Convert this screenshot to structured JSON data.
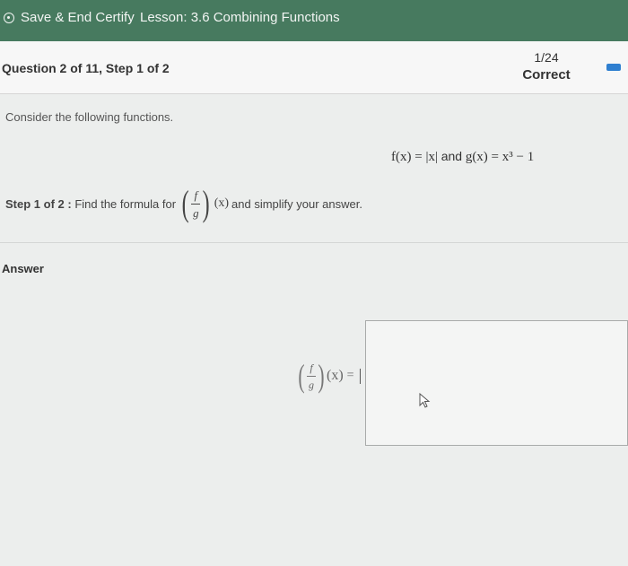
{
  "topbar": {
    "save_end_label": "Save & End Certify",
    "lesson_title": "Lesson: 3.6 Combining Functions"
  },
  "question": {
    "label": "Question 2 of 11, Step 1 of 2",
    "progress_count": "1/24",
    "progress_status": "Correct"
  },
  "content": {
    "intro": "Consider the following functions.",
    "f_def": "f(x) = |x|",
    "conjunction": "and",
    "g_def": "g(x) = x³ − 1",
    "step_label": "Step 1 of 2 :",
    "step_text_before": "Find the formula for",
    "frac_num": "f",
    "frac_den": "g",
    "arg": "(x)",
    "step_text_after": "and simplify your answer."
  },
  "answer": {
    "label": "Answer",
    "frac_num": "f",
    "frac_den": "g",
    "arg": "(x)",
    "equals": "=",
    "value": ""
  },
  "colors": {
    "topbar": "#477a5f",
    "accent": "#2f7fd0"
  },
  "icons": {
    "save": "save-circle-icon",
    "cursor": "mouse-pointer-icon"
  }
}
